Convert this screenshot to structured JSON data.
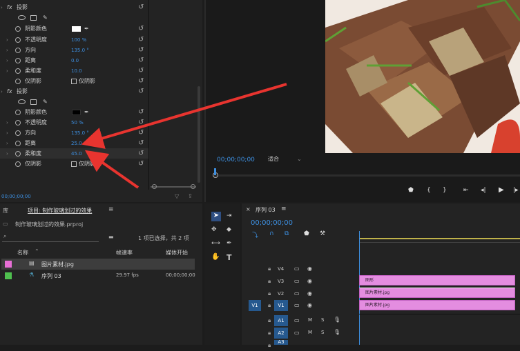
{
  "effect_controls": {
    "shadow1": {
      "header": "投影",
      "props": [
        {
          "label": "阴影颜色",
          "value": ""
        },
        {
          "label": "不透明度",
          "value": "100 %"
        },
        {
          "label": "方向",
          "value": "135.0 °"
        },
        {
          "label": "距离",
          "value": "0.0"
        },
        {
          "label": "柔和度",
          "value": "10.0"
        },
        {
          "label": "仅阴影",
          "value": ""
        }
      ]
    },
    "shadow2": {
      "header": "投影",
      "props": [
        {
          "label": "阴影颜色",
          "value": ""
        },
        {
          "label": "不透明度",
          "value": "50 %"
        },
        {
          "label": "方向",
          "value": "135.0 °"
        },
        {
          "label": "距离",
          "value": "25.0"
        },
        {
          "label": "柔和度",
          "value": "45.0"
        },
        {
          "label": "仅阴影",
          "value": ""
        }
      ]
    },
    "fx": "fx",
    "timecode": "00;00;00;00",
    "shadow_only_label": "仅阴影",
    "colors": {
      "shadow1": "#ffffff",
      "shadow2": "#000000"
    }
  },
  "program_monitor": {
    "timecode": "00;00;00;00",
    "zoom": "适合"
  },
  "project": {
    "tab_library": "库",
    "tab_title": "项目: 制作玻璃划过的效果",
    "file_name": "制作玻璃划过的效果.prproj",
    "selection_info": "1 项已选择，共 2 项",
    "columns": {
      "name": "名称",
      "fps": "帧速率",
      "media_start": "媒体开始"
    },
    "items": [
      {
        "name": "图片素材.jpg",
        "fps": "",
        "start": "",
        "color": "#e86fd6"
      },
      {
        "name": "序列 03",
        "fps": "29.97 fps",
        "start": "00;00;00;00",
        "color": "#4fc04f"
      }
    ]
  },
  "timeline": {
    "title": "序列 03",
    "timecode": "00;00;00;00",
    "video_tracks": [
      "V4",
      "V3",
      "V2",
      "V1"
    ],
    "audio_tracks": [
      "A1",
      "A2",
      "A3"
    ],
    "source_v1": "V1",
    "clips": [
      {
        "track": "V3",
        "label": "图形"
      },
      {
        "track": "V2",
        "label": "图片素材.jpg"
      },
      {
        "track": "V1",
        "label": "图片素材.jpg"
      }
    ],
    "mute_label": "M",
    "solo_label": "S"
  }
}
